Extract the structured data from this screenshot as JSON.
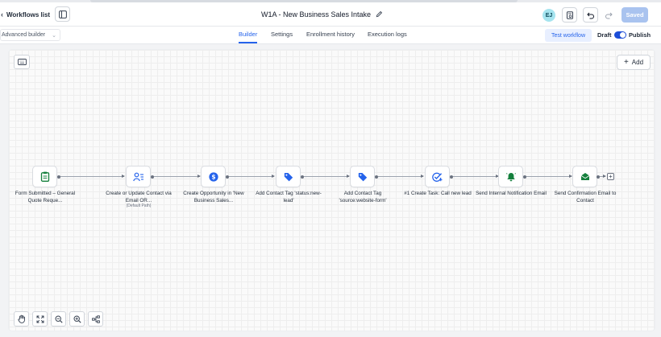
{
  "header": {
    "back_label": "Workflows list",
    "title": "W1A - New Business Sales Intake",
    "avatar_initials": "EJ",
    "saved_label": "Saved"
  },
  "subbar": {
    "builder_mode": "Advanced builder",
    "tabs": [
      {
        "label": "Builder",
        "active": true
      },
      {
        "label": "Settings",
        "active": false
      },
      {
        "label": "Enrollment history",
        "active": false
      },
      {
        "label": "Execution logs",
        "active": false
      }
    ],
    "test_label": "Test workflow",
    "draft_label": "Draft",
    "publish_label": "Publish",
    "published": true
  },
  "canvas": {
    "add_label": "Add",
    "nodes": [
      {
        "label": "Form Submitted – General Quote Reque...",
        "icon": "form-clipboard-icon",
        "color": "#15803d"
      },
      {
        "label": "Create or Update Contact via Email OR...",
        "sublabel": "(Default Path)",
        "icon": "contact-update-icon",
        "color": "#2563eb"
      },
      {
        "label": "Create Opportunity in 'New Business Sales...",
        "icon": "dollar-icon",
        "color": "#2563eb"
      },
      {
        "label": "Add Contact Tag 'status:new-lead'",
        "icon": "tag-icon",
        "color": "#2563eb"
      },
      {
        "label": "Add Contact Tag 'source:website-form'",
        "icon": "tag-icon",
        "color": "#2563eb"
      },
      {
        "label": "#1 Create Task: Call new lead",
        "icon": "task-check-icon",
        "color": "#2563eb"
      },
      {
        "label": "Send Internal Notification Email",
        "icon": "bell-icon",
        "color": "#15803d"
      },
      {
        "label": "Send Confirmation Email to Contact",
        "icon": "envelope-icon",
        "color": "#15803d"
      }
    ]
  },
  "colors": {
    "accent": "#2563eb",
    "saved_bg": "#a9c3ef"
  }
}
